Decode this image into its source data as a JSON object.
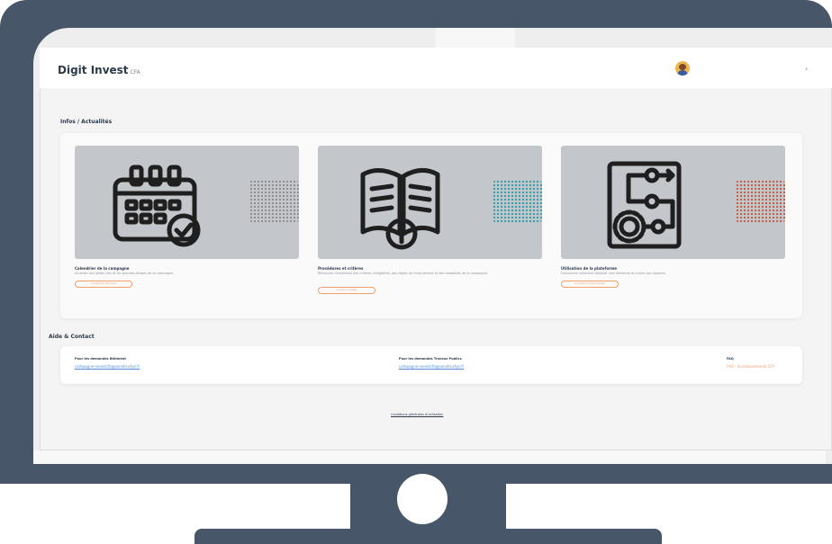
{
  "app": {
    "brand": "Digit Invest",
    "brand_suffix": "CFA"
  },
  "sections": {
    "infos_title": "Infos / Actualités",
    "aide_title": "Aide & Contact"
  },
  "cards": [
    {
      "title": "Calendrier de la campagne",
      "description": "Accédez aux dates clés et les grandes étapes de la campagne.",
      "button": "Consulter le calendrier",
      "icon": "calendar-icon",
      "pattern_color": "#8d8d8d"
    },
    {
      "title": "Procédures et critères",
      "description": "Retrouvez l'ensemble des critères d'éligibilité, des règles de financement et des modalités de la campagne.",
      "button": "Accéder à la page",
      "icon": "book-info-icon",
      "pattern_color": "#2f9fab"
    },
    {
      "title": "Utilisation de la plateforme",
      "description": "Découvrez comment déposer une demande et suivre vos dossiers.",
      "button": "Consulter le mode d'emploi",
      "icon": "workflow-icon",
      "pattern_color": "#c25a42"
    }
  ],
  "contacts": [
    {
      "label": "Pour les demandes Bâtiment",
      "link": "campagne-investcfa@constructys.fr"
    },
    {
      "label": "Pour les demandes Travaux Publics",
      "link": "campagne-investcfa@constructys.fr"
    },
    {
      "label": "FAQ",
      "link": "FAQ - Investissements CFA"
    }
  ],
  "footer": {
    "terms": "Conditions générales d'utilisation"
  },
  "colors": {
    "bezel": "#475669",
    "accent": "#f0a06d",
    "link": "#4f8ad8"
  }
}
